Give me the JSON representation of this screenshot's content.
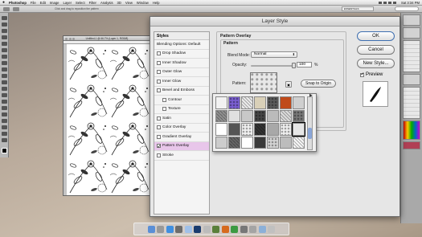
{
  "menubar": {
    "apple": "",
    "app": "Photoshop",
    "items": [
      "File",
      "Edit",
      "Image",
      "Layer",
      "Select",
      "Filter",
      "Analysis",
      "3D",
      "View",
      "Window",
      "Help"
    ],
    "clock": "Sat 3:34 PM"
  },
  "optbar": {
    "hint": "Click and drag to reposition the pattern",
    "workspace": "ESSENTIALS"
  },
  "document": {
    "title": "Untitled-1 @ 66.7% (Layer 1, RGB/8)"
  },
  "dialog": {
    "title": "Layer Style",
    "styles_header": "Styles",
    "blending_options": "Blending Options: Default",
    "effects": [
      {
        "label": "Drop Shadow",
        "checked": false,
        "sub": false
      },
      {
        "label": "Inner Shadow",
        "checked": false,
        "sub": false
      },
      {
        "label": "Outer Glow",
        "checked": false,
        "sub": false
      },
      {
        "label": "Inner Glow",
        "checked": false,
        "sub": false
      },
      {
        "label": "Bevel and Emboss",
        "checked": false,
        "sub": false
      },
      {
        "label": "Contour",
        "checked": false,
        "sub": true
      },
      {
        "label": "Texture",
        "checked": false,
        "sub": true
      },
      {
        "label": "Satin",
        "checked": false,
        "sub": false
      },
      {
        "label": "Color Overlay",
        "checked": false,
        "sub": false
      },
      {
        "label": "Gradient Overlay",
        "checked": false,
        "sub": false
      },
      {
        "label": "Pattern Overlay",
        "checked": true,
        "sub": false,
        "selected": true
      },
      {
        "label": "Stroke",
        "checked": false,
        "sub": false
      }
    ],
    "section_title": "Pattern Overlay",
    "group_title": "Pattern",
    "blend_mode_label": "Blend Mode:",
    "blend_mode_value": "Normal",
    "opacity_label": "Opacity:",
    "opacity_value": "100",
    "opacity_unit": "%",
    "opacity_fraction": 1.0,
    "pattern_label": "Pattern:",
    "snap_button": "Snap to Origin",
    "ok_button": "OK",
    "cancel_button": "Cancel",
    "new_style_button": "New Style...",
    "preview_label": "Preview",
    "preview_checked": true
  },
  "picker": {
    "swatch_colors": [
      "#f2f2f2",
      "#7a5fd0",
      "#ececec",
      "#d9d0b8",
      "#5a5a5a",
      "#c04a1a",
      "#cfcfcf",
      "#909090",
      "#e0e0e0",
      "#c8c8c8",
      "#444444",
      "#bbbbbb",
      "#dddddd",
      "#777777",
      "#ffffff",
      "#555555",
      "#f0f0f0",
      "#333333",
      "#a8a8a8",
      "#eeeeee",
      "#e6e6e6",
      "#cccccc",
      "#666666",
      "#ffffff",
      "#3a3a3a",
      "#d4d4d4",
      "#bcbcbc",
      "#f7f7f7"
    ],
    "selected_index": 20
  },
  "colors": {
    "selected_row": "#e8c6ea",
    "dialog_bg": "#e6e6e6"
  }
}
